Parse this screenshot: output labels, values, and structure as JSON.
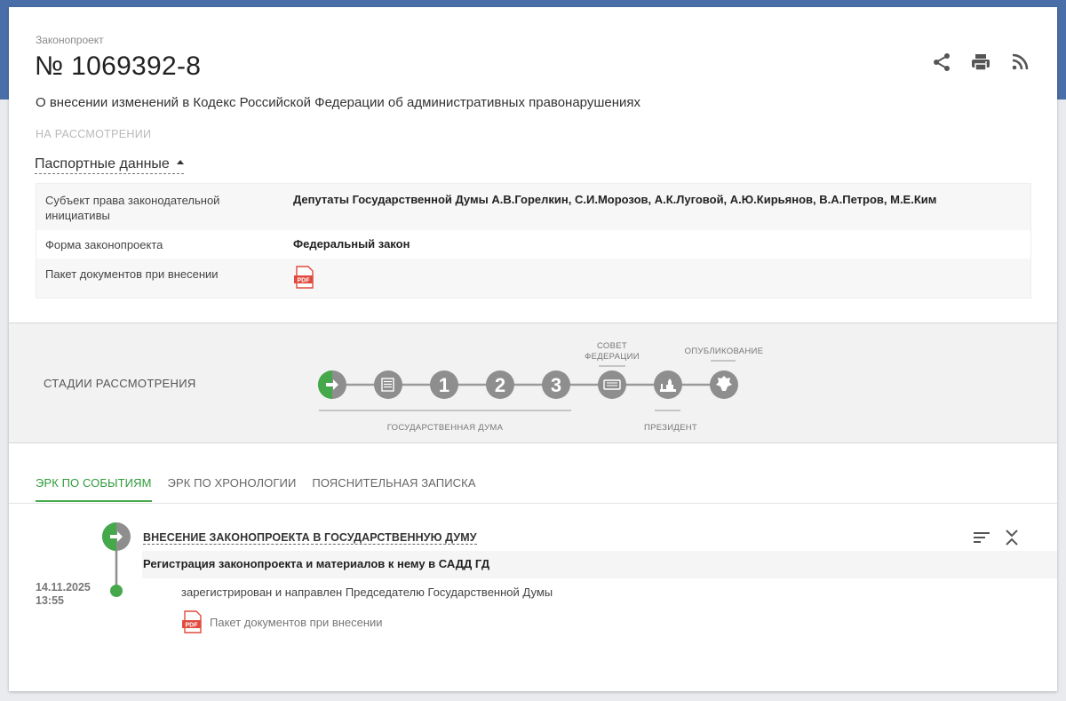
{
  "bill": {
    "label": "Законопроект",
    "number": "№ 1069392-8",
    "title": "О внесении изменений в Кодекс Российской Федерации об административных правонарушениях",
    "status": "НА РАССМОТРЕНИИ"
  },
  "passport": {
    "toggle_label": "Паспортные данные",
    "rows": [
      {
        "key": "Субъект права законодательной инициативы",
        "value": "Депутаты Государственной Думы А.В.Горелкин, С.И.Морозов, А.К.Луговой, А.Ю.Кирьянов, В.А.Петров, М.Е.Ким"
      },
      {
        "key": "Форма законопроекта",
        "value": "Федеральный закон"
      },
      {
        "key": "Пакет документов при внесении",
        "value": ""
      }
    ],
    "pdf_label": "PDF"
  },
  "stages": {
    "title": "СТАДИИ РАССМОТРЕНИЯ",
    "steps": [
      "",
      "",
      "1",
      "2",
      "3",
      "",
      "",
      ""
    ],
    "group_duma": "ГОСУДАРСТВЕННАЯ ДУМА",
    "sovfed_line1": "СОВЕТ",
    "sovfed_line2": "ФЕДЕРАЦИИ",
    "president": "ПРЕЗИДЕНТ",
    "publish": "ОПУБЛИКОВАНИЕ"
  },
  "tabs": [
    {
      "label": "ЭРК ПО СОБЫТИЯМ",
      "active": true
    },
    {
      "label": "ЭРК ПО ХРОНОЛОГИИ",
      "active": false
    },
    {
      "label": "ПОЯСНИТЕЛЬНАЯ ЗАПИСКА",
      "active": false
    }
  ],
  "event": {
    "title": "ВНЕСЕНИЕ ЗАКОНОПРОЕКТА В ГОСУДАРСТВЕННУЮ ДУМУ",
    "subtitle": "Регистрация законопроекта и материалов к нему в САДД ГД",
    "date": "14.11.2025",
    "time": "13:55",
    "text": "зарегистрирован и направлен Председателю Государственной Думы",
    "doc_label": "Пакет документов при внесении",
    "pdf_label": "PDF"
  },
  "colors": {
    "accent_green": "#45a84b",
    "stage_gray": "#8e8e8e",
    "pdf_red": "#e04a3f",
    "header_blue": "#4a6fa8"
  }
}
